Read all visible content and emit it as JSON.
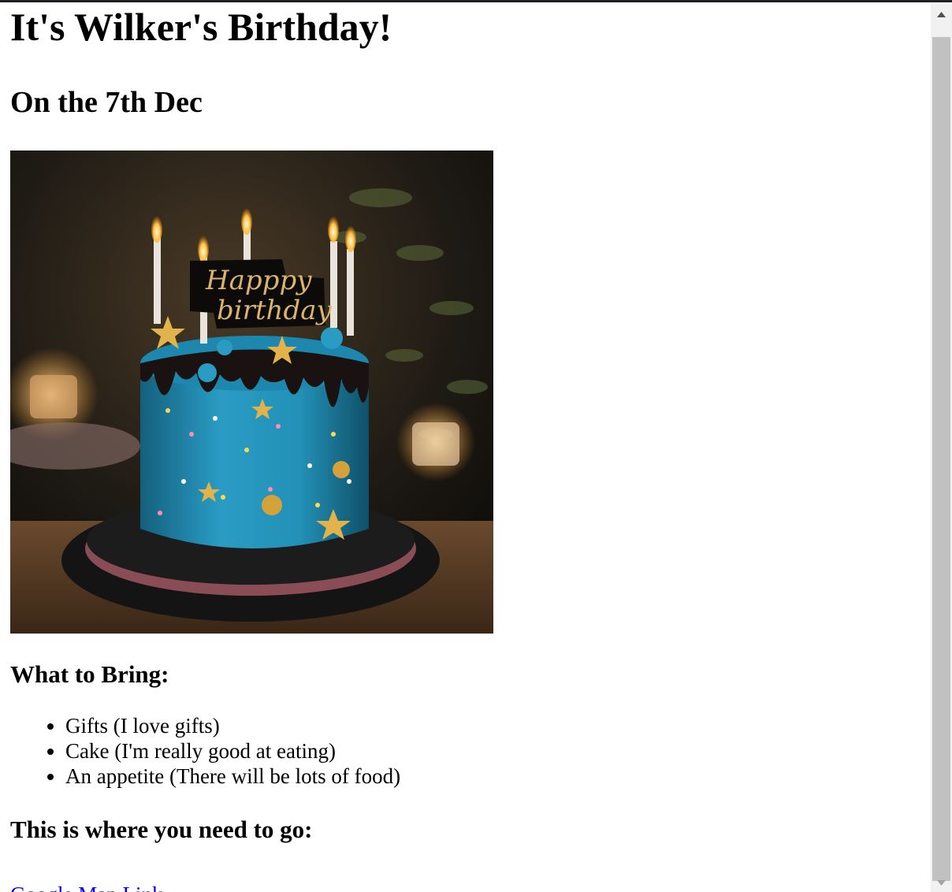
{
  "page": {
    "title": "It's Wilker's Birthday!",
    "subtitle": "On the 7th Dec"
  },
  "image": {
    "description_icon": "birthday-cake-photo",
    "topper_text_line1": "Happpy",
    "topper_text_line2": "birthday"
  },
  "bring": {
    "heading": "What to Bring:",
    "items": [
      "Gifts (I love gifts)",
      "Cake (I'm really good at eating)",
      "An appetite (There will be lots of food)"
    ]
  },
  "location": {
    "heading": "This is where you need to go:",
    "link_label": "Google Map Link"
  },
  "scrollbar": {
    "up_icon": "triangle-up-icon",
    "down_icon": "triangle-down-icon"
  },
  "colors": {
    "link": "#0000ee",
    "frosting": "#1f8fb5",
    "scroll_thumb": "#c1c1c1"
  }
}
